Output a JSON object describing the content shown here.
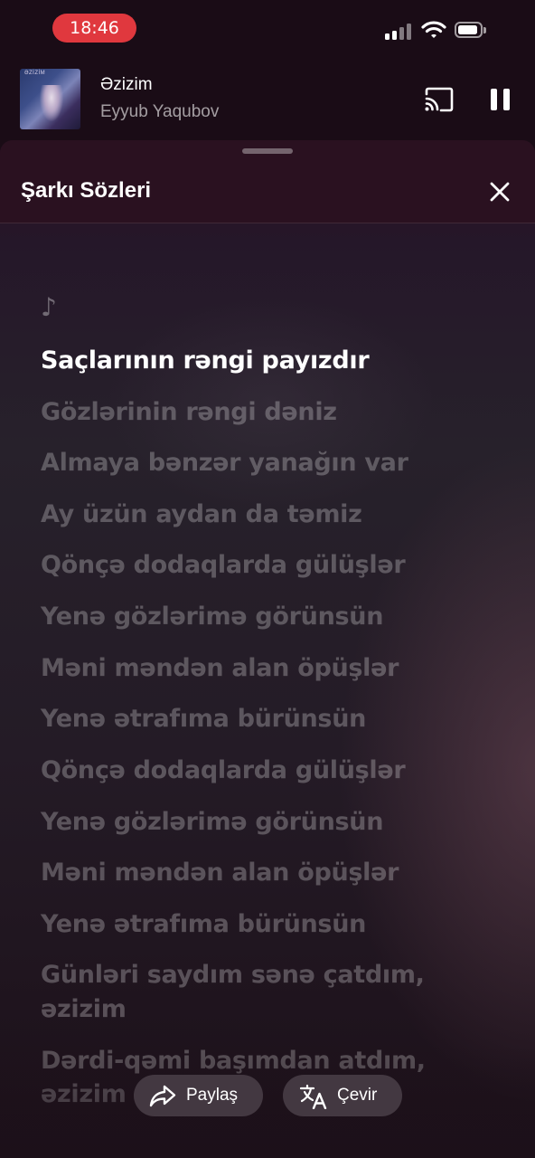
{
  "status_bar": {
    "time": "18:46",
    "time_pill_color": "#e0383e"
  },
  "now_playing": {
    "title": "Əzizim",
    "artist": "Eyyub Yaqubov",
    "artwork_text": "ƏZİZİM",
    "cast_icon": "cast-icon",
    "pause_icon": "pause-icon"
  },
  "lyrics_sheet": {
    "title": "Şarkı Sözleri",
    "close_icon": "close-icon",
    "intro_icon": "music-note-icon",
    "intro_glyph": "♪",
    "active_index": 0,
    "lines": [
      "Saçlarının rəngi payızdır",
      "Gözlərinin rəngi dəniz",
      "Almaya bənzər yanağın var",
      "Ay üzün aydan da təmiz",
      "Qönçə dodaqlarda gülüşlər",
      "Yenə gözlərimə görünsün",
      "Məni məndən alan öpüşlər",
      "Yenə ətrafıma bürünsün",
      "Qönçə dodaqlarda gülüşlər",
      "Yenə gözlərimə görünsün",
      "Məni məndən alan öpüşlər",
      "Yenə ətrafıma bürünsün",
      "Günləri saydım sənə çatdım,",
      "əzizim",
      "Dərdi-qəmi başımdan atdım,",
      "əzizim"
    ]
  },
  "actions": {
    "share_label": "Paylaş",
    "share_icon": "share-icon",
    "translate_label": "Çevir",
    "translate_icon": "translate-icon"
  }
}
